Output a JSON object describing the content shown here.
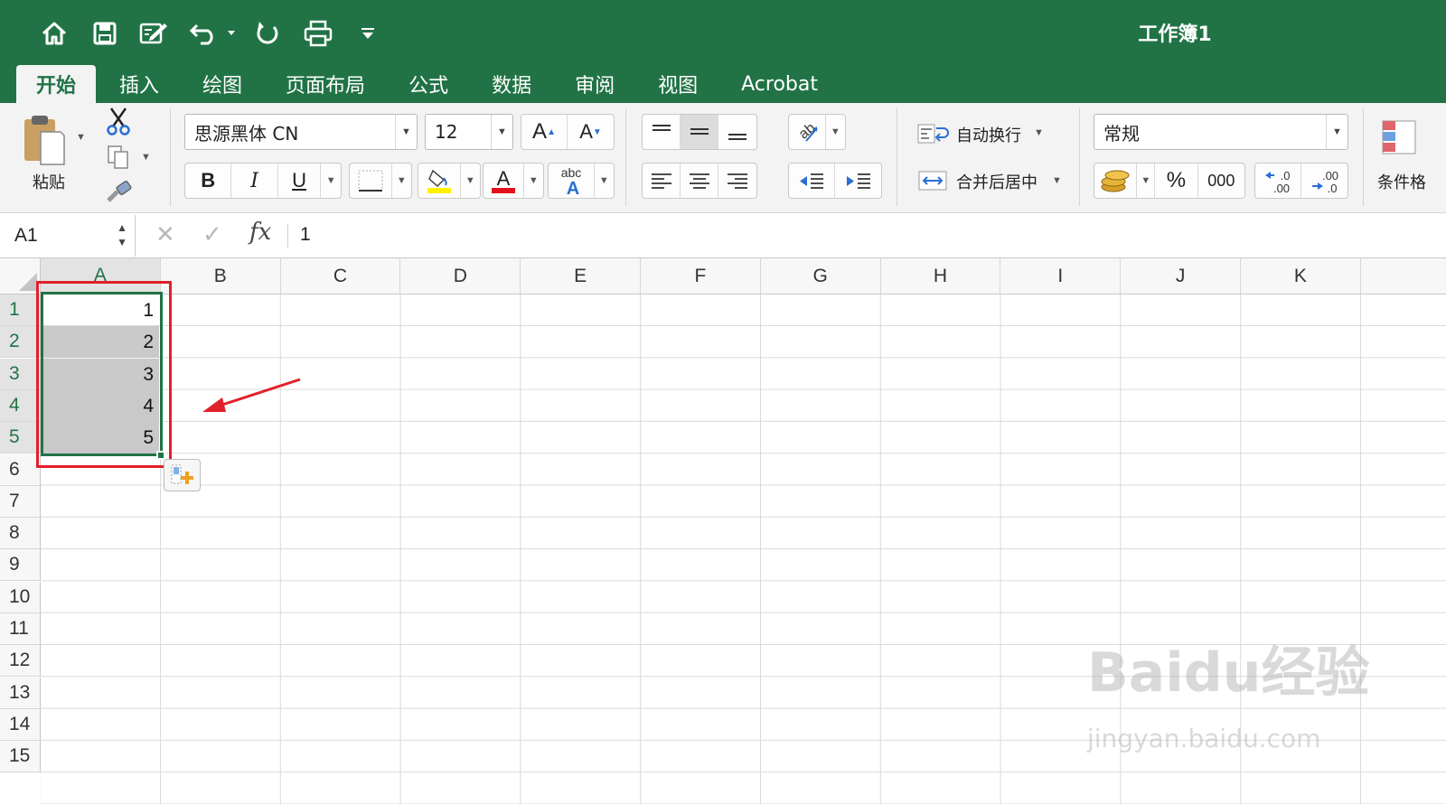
{
  "window": {
    "title": "工作簿1"
  },
  "quick_access": [
    {
      "name": "home-icon"
    },
    {
      "name": "save-icon"
    },
    {
      "name": "edit-icon"
    },
    {
      "name": "undo-icon"
    },
    {
      "name": "redo-icon"
    },
    {
      "name": "print-icon"
    },
    {
      "name": "customize-icon"
    }
  ],
  "tabs": [
    {
      "label": "开始",
      "active": true
    },
    {
      "label": "插入"
    },
    {
      "label": "绘图"
    },
    {
      "label": "页面布局"
    },
    {
      "label": "公式"
    },
    {
      "label": "数据"
    },
    {
      "label": "审阅"
    },
    {
      "label": "视图"
    },
    {
      "label": "Acrobat"
    }
  ],
  "ribbon": {
    "paste_label": "粘贴",
    "font_name": "思源黑体 CN",
    "font_size": "12",
    "bold": "B",
    "italic": "I",
    "underline": "U",
    "wrap_text": "自动换行",
    "merge_center": "合并后居中",
    "number_format": "常规",
    "percent": "%",
    "thousands": "000",
    "conditional_format": "条件格"
  },
  "formula_bar": {
    "name_box": "A1",
    "value": "1",
    "fx": "fx"
  },
  "sheet": {
    "columns": [
      "A",
      "B",
      "C",
      "D",
      "E",
      "F",
      "G",
      "H",
      "I",
      "J",
      "K"
    ],
    "rows": [
      "1",
      "2",
      "3",
      "4",
      "5",
      "6",
      "7",
      "8",
      "9",
      "10",
      "11",
      "12",
      "13",
      "14",
      "15"
    ],
    "cells_A": [
      "1",
      "2",
      "3",
      "4",
      "5"
    ],
    "selected_range": "A1:A5"
  },
  "watermark": {
    "line1": "Baidu经验",
    "line2": "jingyan.baidu.com"
  },
  "colors": {
    "excel_green": "#217346",
    "annotation_red": "#e0202a"
  }
}
